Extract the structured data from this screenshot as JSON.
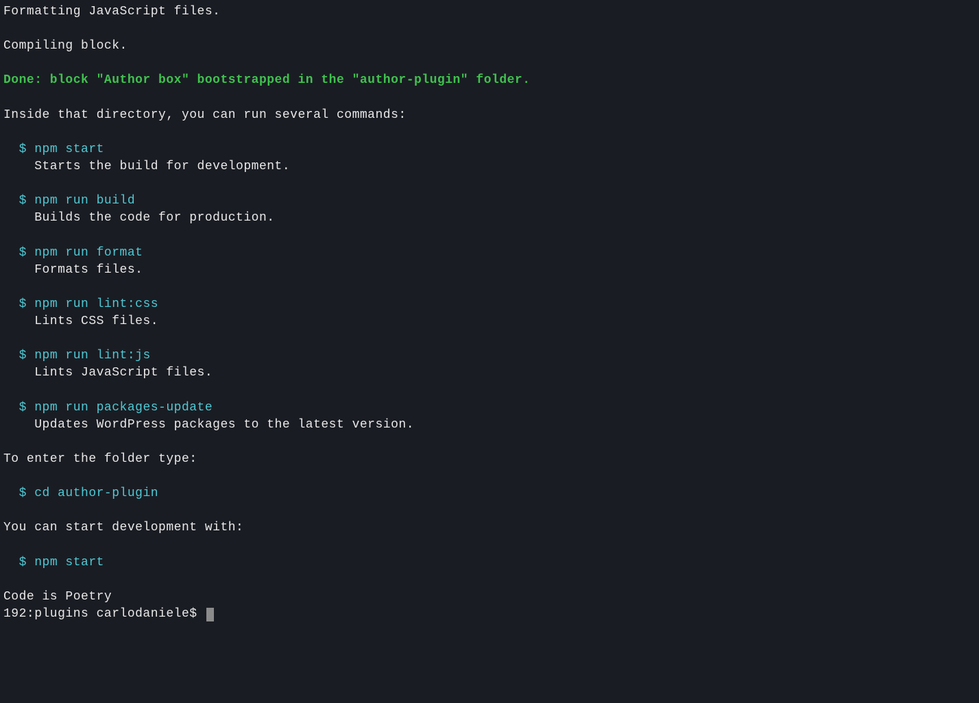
{
  "header": {
    "line1": "Formatting JavaScript files.",
    "line2": "Compiling block.",
    "done": "Done: block \"Author box\" bootstrapped in the \"author-plugin\" folder.",
    "intro": "Inside that directory, you can run several commands:"
  },
  "commands": [
    {
      "prefix": "  $ ",
      "cmd": "npm start",
      "desc": "    Starts the build for development."
    },
    {
      "prefix": "  $ ",
      "cmd": "npm run build",
      "desc": "    Builds the code for production."
    },
    {
      "prefix": "  $ ",
      "cmd": "npm run format",
      "desc": "    Formats files."
    },
    {
      "prefix": "  $ ",
      "cmd": "npm run lint:css",
      "desc": "    Lints CSS files."
    },
    {
      "prefix": "  $ ",
      "cmd": "npm run lint:js",
      "desc": "    Lints JavaScript files."
    },
    {
      "prefix": "  $ ",
      "cmd": "npm run packages-update",
      "desc": "    Updates WordPress packages to the latest version."
    }
  ],
  "footer": {
    "enter_folder": "To enter the folder type:",
    "cd_prefix": "  $ ",
    "cd_cmd": "cd author-plugin",
    "start_dev": "You can start development with:",
    "start_prefix": "  $ ",
    "start_cmd": "npm start",
    "poetry": "Code is Poetry",
    "prompt": "192:plugins carlodaniele$ "
  }
}
